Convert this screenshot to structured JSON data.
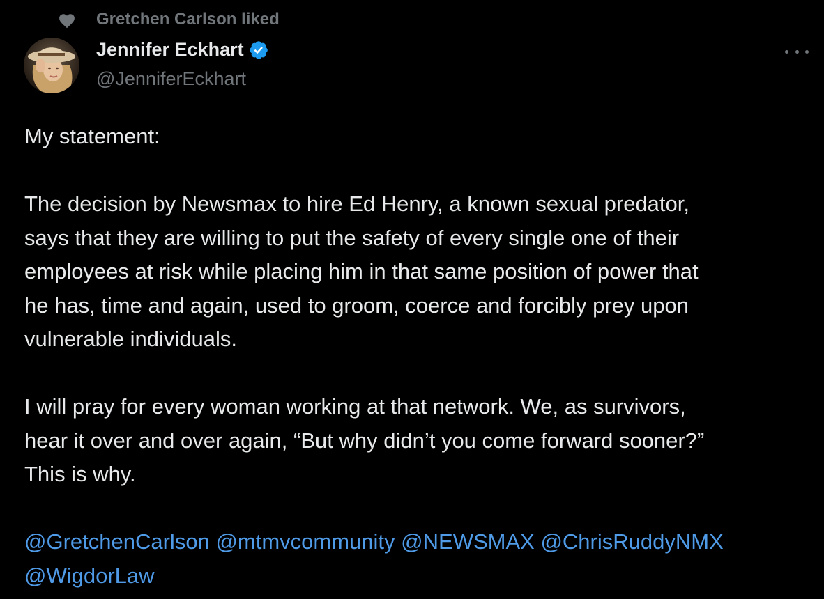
{
  "social_context": {
    "label": "Gretchen Carlson liked",
    "icon": "heart-icon"
  },
  "author": {
    "display_name": "Jennifer Eckhart",
    "handle": "@JenniferEckhart",
    "verified": true,
    "verified_color": "#1d9bf0"
  },
  "tweet": {
    "paragraph1": [
      "My statement:"
    ],
    "paragraph2": [
      "The decision by Newsmax to hire Ed Henry, a known sexual predator,",
      "says that they are willing to put the safety of every single one of their",
      "employees at risk while placing him in that same position of power that",
      "he has, time and again, used to groom, coerce and forcibly prey upon",
      "vulnerable individuals."
    ],
    "paragraph3": [
      "I will pray for every woman working at that network. We, as survivors,",
      "hear it over and over again, “But why didn’t you come forward sooner?”",
      "This is why."
    ],
    "mentions_line1": [
      "@GretchenCarlson",
      "@mtmvcommunity",
      "@NEWSMAX",
      "@ChrisRuddyNMX"
    ],
    "mentions_line2": [
      "@WigdorLaw"
    ]
  },
  "colors": {
    "background": "#000000",
    "text": "#e7e9ea",
    "muted": "#71767b",
    "link": "#4f9be8"
  }
}
